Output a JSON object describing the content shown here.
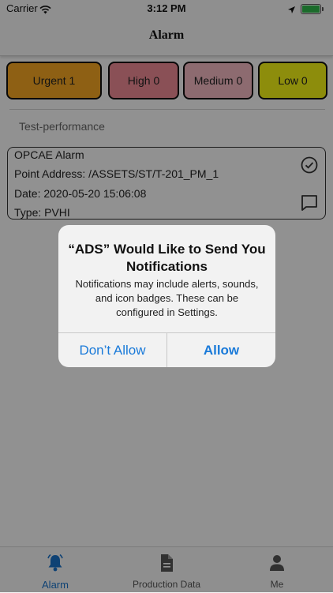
{
  "status_bar": {
    "carrier": "Carrier",
    "time": "3:12 PM"
  },
  "nav": {
    "title": "Alarm"
  },
  "levels": [
    {
      "label": "Urgent 1",
      "color": "#f5a623"
    },
    {
      "label": "High 0",
      "color": "#ee8b94"
    },
    {
      "label": "Medium 0",
      "color": "#f3b9c2"
    },
    {
      "label": "Low 0",
      "color": "#f3f316"
    }
  ],
  "section_title": "Test-performance",
  "alarm_card": {
    "name": "OPCAE Alarm",
    "point_address": "Point Address: /ASSETS/ST/T-201_PM_1",
    "date": "Date: 2020-05-20 15:06:08",
    "type": "Type: PVHI",
    "icons": [
      "check-circle-icon",
      "chat-bubble-icon"
    ]
  },
  "dialog": {
    "title": "“ADS” Would Like to Send You Notifications",
    "message": "Notifications may include alerts, sounds, and icon badges. These can be configured in Settings.",
    "deny_label": "Don’t Allow",
    "allow_label": "Allow"
  },
  "tabbar": {
    "tabs": [
      {
        "label": "Alarm",
        "icon": "bell-icon",
        "active": true
      },
      {
        "label": "Production Data",
        "icon": "document-icon",
        "active": false
      },
      {
        "label": "Me",
        "icon": "person-icon",
        "active": false
      }
    ],
    "accent": "#1a73c9"
  }
}
